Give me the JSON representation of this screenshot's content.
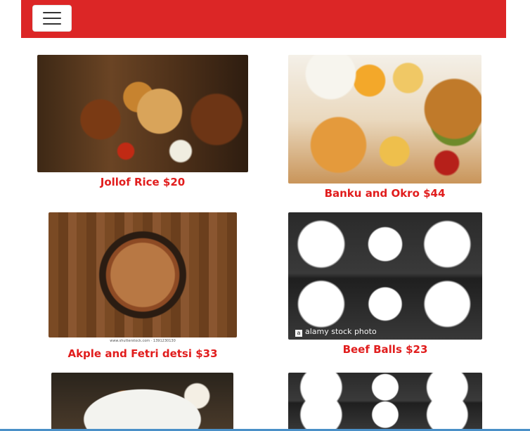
{
  "navbar": {
    "toggle_icon": "hamburger-menu-icon",
    "color": "#dc2626"
  },
  "menu_items": [
    {
      "name": "Jollof Rice $20"
    },
    {
      "name": "Banku and Okro $44"
    },
    {
      "name": "Akple and Fetri detsi $33",
      "watermark_caption": "www.shutterstock.com · 1391230130"
    },
    {
      "name": "Beef Balls $23",
      "watermark": "alamy stock photo"
    },
    {
      "name": ""
    },
    {
      "name": ""
    }
  ],
  "colors": {
    "caption": "#e11d1d",
    "navbar": "#dc2626"
  }
}
